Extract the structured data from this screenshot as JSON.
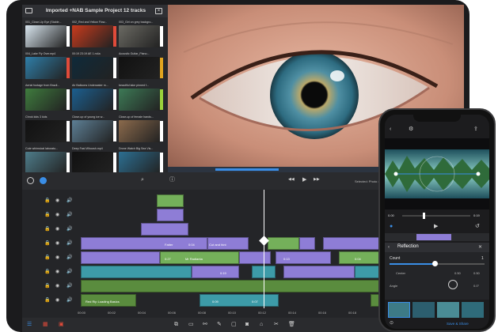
{
  "browser": {
    "title": "Imported +NAB Sample Project 12 tracks",
    "items": [
      {
        "label": "001_Close-Up Eye (Stable...",
        "meta": "00:11  3840x2160 · 30 fps",
        "color": "#d9e6ef",
        "badge": "#ffffff"
      },
      {
        "label": "002_Red and Yellow Flow...",
        "meta": "00:15  3840x2160 · 30 fps",
        "color": "#c83b1d",
        "badge": "#e04b3a"
      },
      {
        "label": "003_Girl on grey backgro...",
        "meta": "00:09  1920x1080 · 25 fps",
        "color": "#6b6a63",
        "badge": "#ffffff"
      },
      {
        "label": "004_Lake Fly Over.mp4",
        "meta": "00:12  1920x1080",
        "color": "#2f7ea8",
        "badge": "#e04b3a"
      },
      {
        "label": "00:19  23:19  AE 1.m4a",
        "meta": "",
        "color": "#0f2a3a",
        "badge": "#ffffff"
      },
      {
        "label": "Acoustic Guitar_Piano...",
        "meta": "",
        "color": "#111111",
        "badge": "#e0a41f"
      },
      {
        "label": "Aerial footage from Brazil...",
        "meta": "",
        "color": "#3f7c3e",
        "badge": "#ffffff"
      },
      {
        "label": "Air Balloons Underwater m...",
        "meta": "",
        "color": "#1c5f8f",
        "badge": "#ffffff"
      },
      {
        "label": "beautiful lake pinned f...",
        "meta": "",
        "color": "#3d7a56",
        "badge": "#9ad13b"
      },
      {
        "label": "Chrok kids 3 kids",
        "meta": "",
        "color": "#111111",
        "badge": "#ffffff"
      },
      {
        "label": "Close-up of young ice w...",
        "meta": "",
        "color": "#5d7f95",
        "badge": "#ffffff"
      },
      {
        "label": "Close-up of female hands...",
        "meta": "",
        "color": "#8b6a4c",
        "badge": "#ffffff"
      },
      {
        "label": "Cute whimsical laborato...",
        "meta": "",
        "color": "#4e7c8a",
        "badge": "#ffffff"
      },
      {
        "label": "Deep Fast Whoosh.mp4",
        "meta": "",
        "color": "#111111",
        "badge": "#ffffff"
      },
      {
        "label": "Drone Watch Big Sea Vis...",
        "meta": "",
        "color": "#2c6f92",
        "badge": "#ffffff"
      }
    ]
  },
  "transport": {
    "play_glyph": "▶",
    "prev_glyph": "◀◀",
    "next_glyph": "▶▶",
    "project_label": "Selected: Photo @"
  },
  "timeline": {
    "clip_labels": [
      "Fatter",
      "0:04",
      "Cut and hint",
      "0:27",
      "Mr Radianta",
      "0:19",
      "0:13",
      "0:09",
      "0:07",
      "0:04",
      "Red Rip Loading Basics"
    ],
    "ruler": [
      "00:00",
      "00:02",
      "00:04",
      "00:06",
      "00:08",
      "00:10",
      "00:12",
      "00:14",
      "00:16",
      "00:18",
      "00:20",
      "00:22",
      "00:24"
    ]
  },
  "iphone": {
    "time_left": "0.00",
    "time_right": "0:19",
    "effect_name": "Reflection",
    "param_count_label": "Count",
    "param_count_value": "1",
    "param_center_label": "Center",
    "param_center_x": "0.50",
    "param_center_y": "0.50",
    "param_angle_label": "Angle",
    "param_angle_value": "0.0°",
    "save_label": "Save & Share"
  },
  "colors": {
    "accent_blue": "#3a8ee6",
    "clip_purple": "#8e7dd6",
    "clip_green": "#74b05a",
    "clip_teal": "#3d9ba8",
    "audio_green": "#5a8c3e",
    "playhead": "#e53935"
  },
  "icons": [
    "folder-icon",
    "close-icon",
    "search-icon",
    "info-icon",
    "play-icon",
    "scissors-icon",
    "lock-icon",
    "eye-icon",
    "speaker-icon",
    "share-icon"
  ]
}
